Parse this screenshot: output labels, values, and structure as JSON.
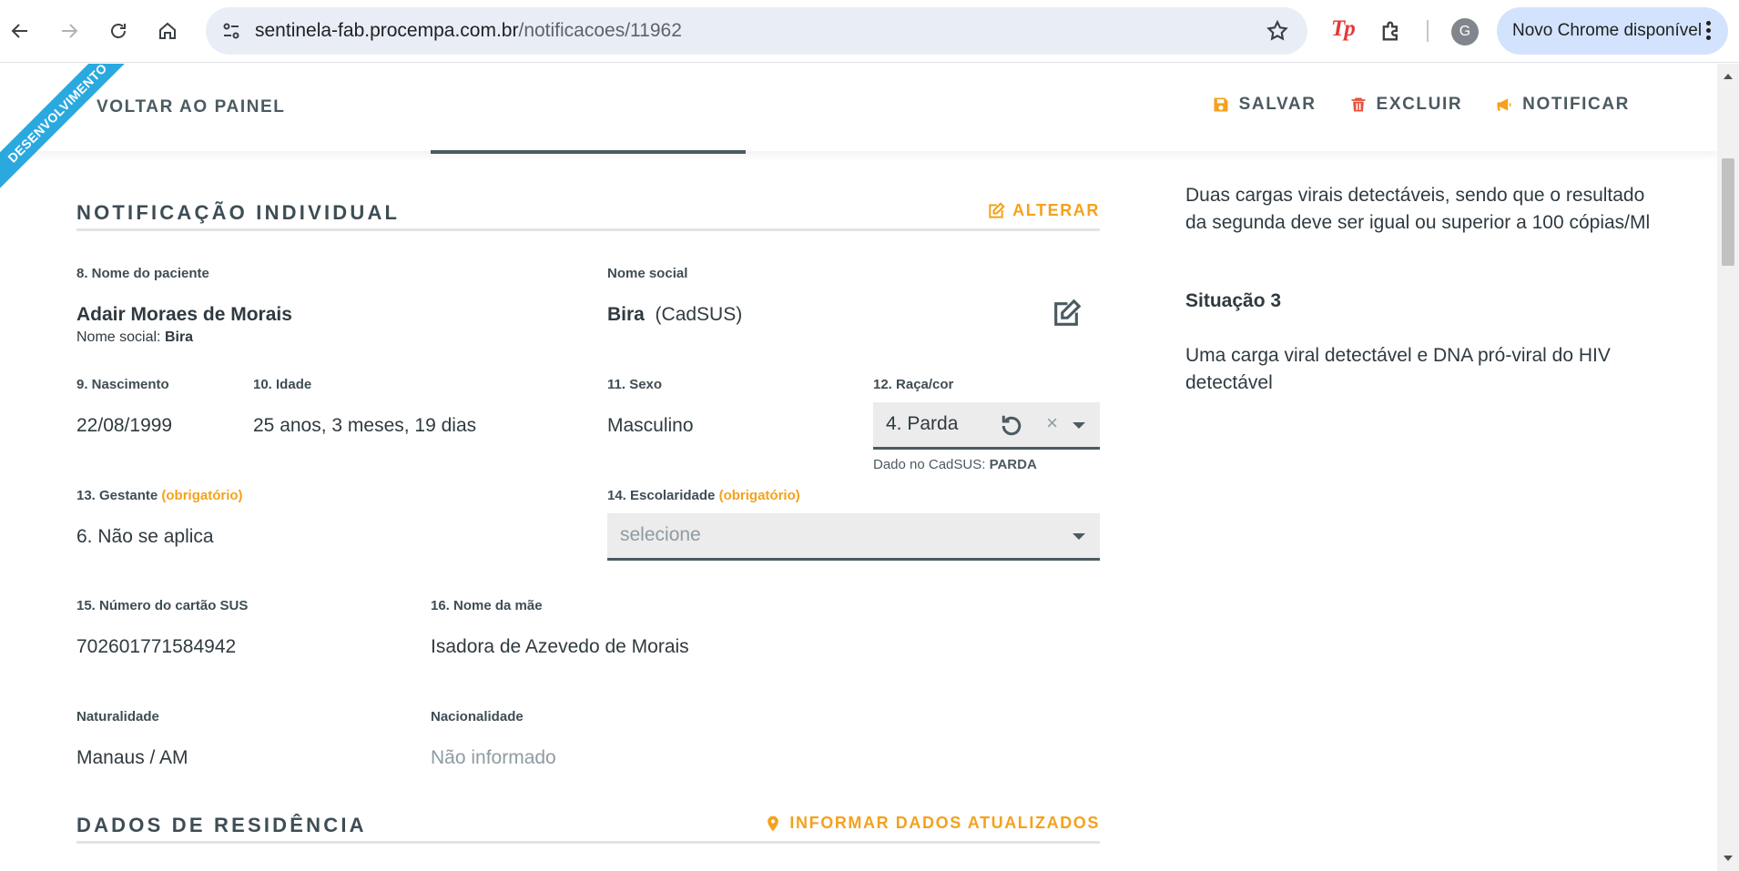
{
  "browser": {
    "url_host": "sentinela-fab.procempa.com.br",
    "url_path": "/notificacoes/11962",
    "ext_tp_label": "Tp",
    "profile_initial": "G",
    "update_label": "Novo Chrome disponível"
  },
  "app": {
    "dev_ribbon": "DESENVOLVIMENTO",
    "back_label": "VOLTAR AO PAINEL",
    "actions": {
      "save": "SALVAR",
      "delete": "EXCLUIR",
      "notify": "NOTIFICAR"
    }
  },
  "notificacao": {
    "title": "NOTIFICAÇÃO INDIVIDUAL",
    "alter_label": "ALTERAR",
    "nome_paciente_label": "8. Nome do paciente",
    "nome_paciente": "Adair Moraes de Morais",
    "nome_social_inline_label": "Nome social:",
    "nome_social_inline": "Bira",
    "nome_social_label": "Nome social",
    "nome_social": "Bira",
    "nome_social_source": "(CadSUS)",
    "nascimento_label": "9. Nascimento",
    "nascimento": "22/08/1999",
    "idade_label": "10. Idade",
    "idade": "25 anos, 3 meses, 19 dias",
    "sexo_label": "11. Sexo",
    "sexo": "Masculino",
    "raca_label": "12. Raça/cor",
    "raca_value": "4. Parda",
    "raca_clear": "×",
    "raca_cadsus_label": "Dado no CadSUS:",
    "raca_cadsus_value": "PARDA",
    "gestante_label": "13. Gestante",
    "obrigatorio": "(obrigatório)",
    "gestante": "6. Não se aplica",
    "escolaridade_label": "14. Escolaridade",
    "escolaridade_placeholder": "selecione",
    "cartao_sus_label": "15. Número do cartão SUS",
    "cartao_sus": "702601771584942",
    "nome_mae_label": "16. Nome da mãe",
    "nome_mae": "Isadora de Azevedo de Morais",
    "naturalidade_label": "Naturalidade",
    "naturalidade": "Manaus / AM",
    "nacionalidade_label": "Nacionalidade",
    "nacionalidade": "Não informado"
  },
  "residencia": {
    "title": "DADOS DE RESIDÊNCIA",
    "update_label": "INFORMAR DADOS ATUALIZADOS"
  },
  "side": {
    "situacao2_text": "Duas cargas virais detectáveis, sendo que o resultado da segunda deve ser igual ou superior a 100 cópias/Ml",
    "situacao3_title": "Situação 3",
    "situacao3_text": "Uma carga viral detectável e DNA pró-viral do HIV detectável"
  },
  "colors": {
    "accent": "#f5a11c",
    "ribbon": "#2aa9df",
    "text_dark": "#3e4d55"
  }
}
